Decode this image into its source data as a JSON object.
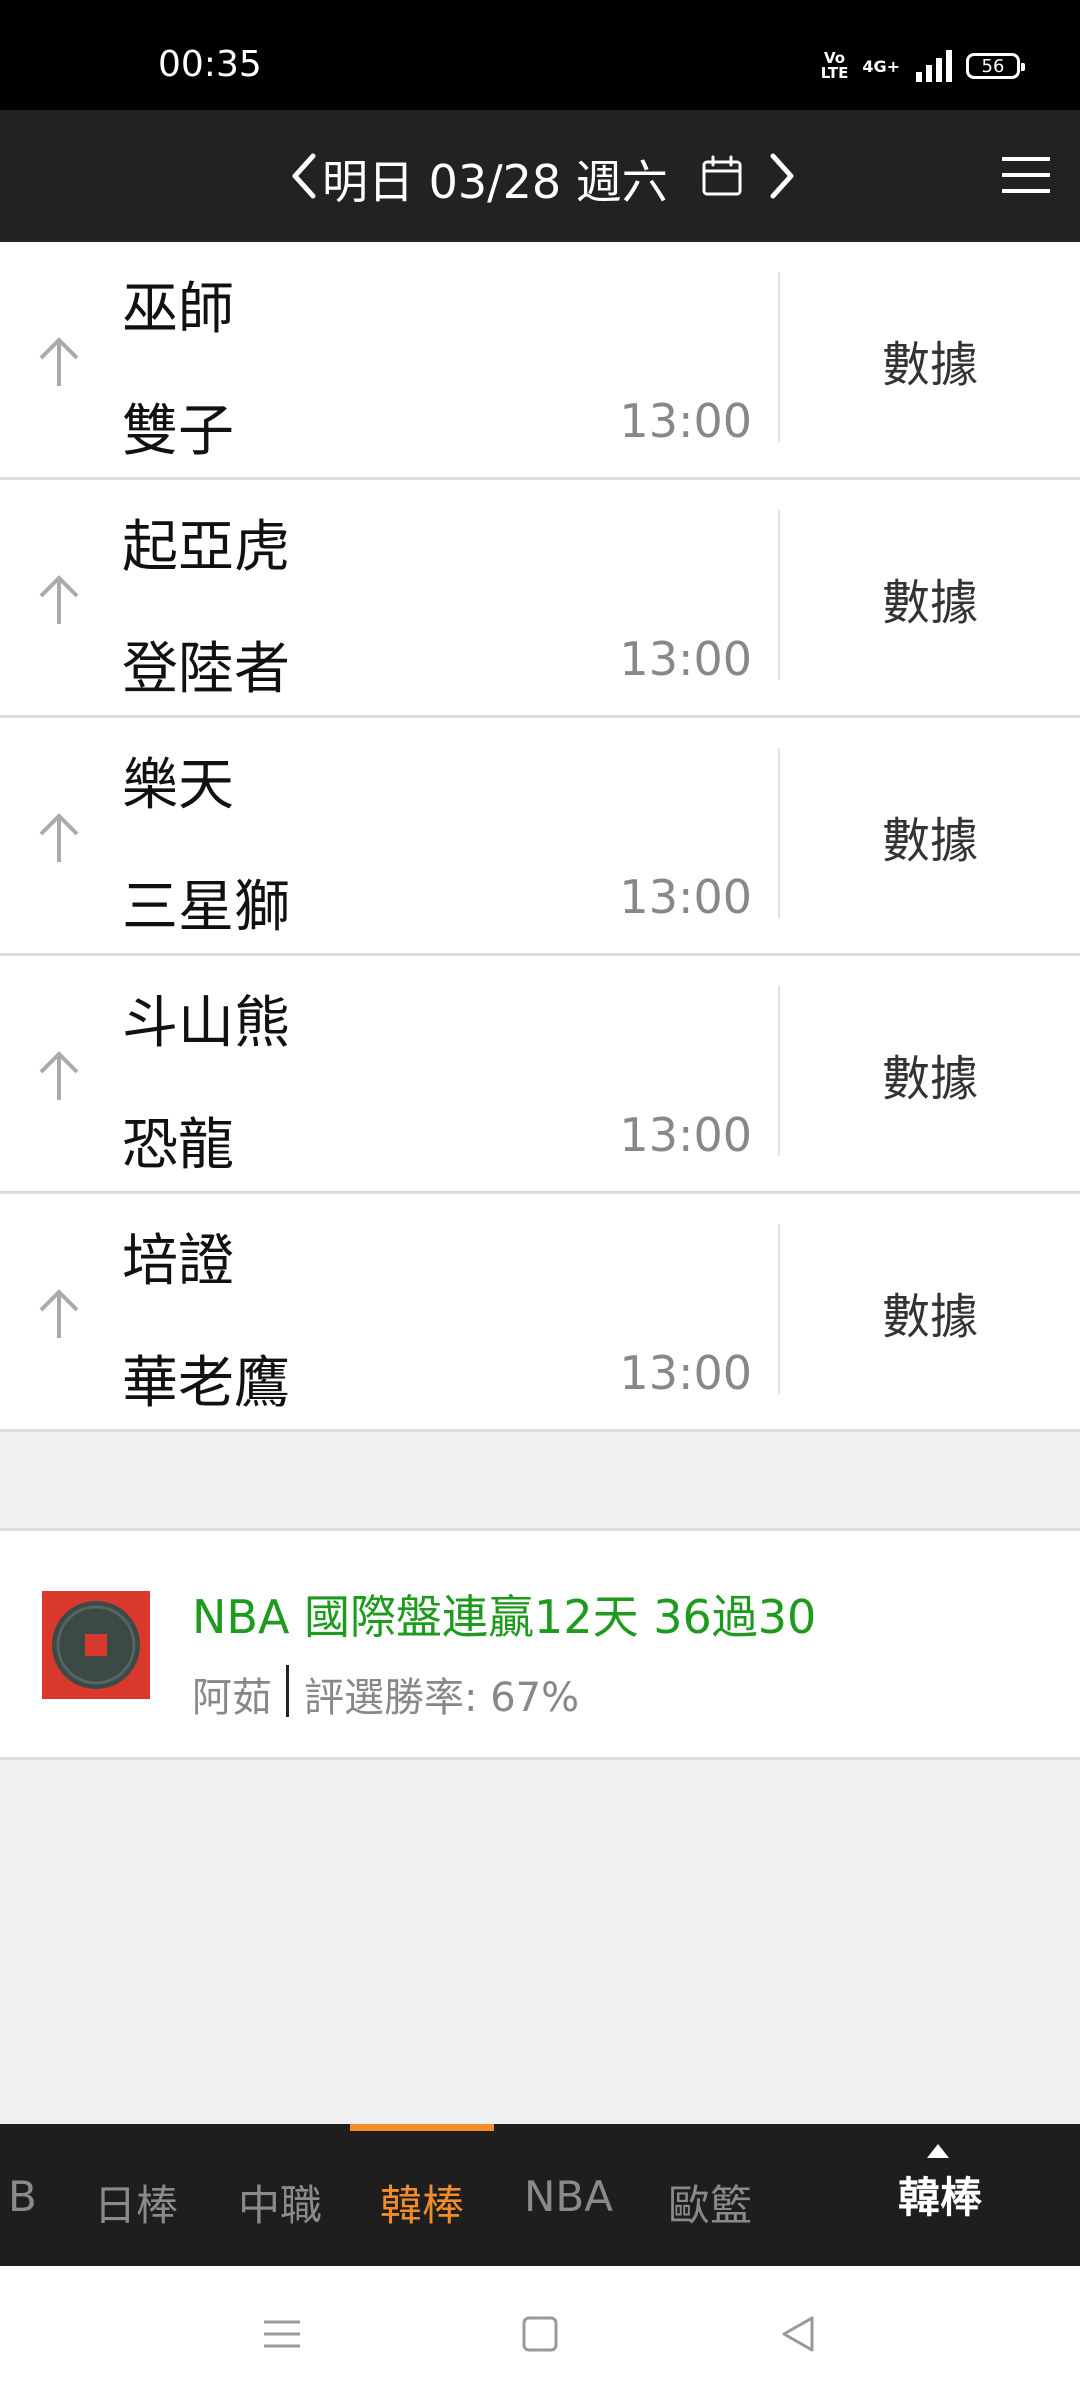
{
  "status_bar": {
    "time": "00:35",
    "volte": "Vo LTE",
    "network": "4G+",
    "battery": "56"
  },
  "header": {
    "date_label": "明日 03/28 週六"
  },
  "games": [
    {
      "home": "巫師",
      "away": "雙子",
      "time": "13:00",
      "action": "數據"
    },
    {
      "home": "起亞虎",
      "away": "登陸者",
      "time": "13:00",
      "action": "數據"
    },
    {
      "home": "樂天",
      "away": "三星獅",
      "time": "13:00",
      "action": "數據"
    },
    {
      "home": "斗山熊",
      "away": "恐龍",
      "time": "13:00",
      "action": "數據"
    },
    {
      "home": "培證",
      "away": "華老鷹",
      "time": "13:00",
      "action": "數據"
    }
  ],
  "promo": {
    "title": "NBA 國際盤連贏12天 36過30",
    "author": "阿茹",
    "win_rate": "評選勝率: 67%"
  },
  "tabs": {
    "items": [
      "B",
      "日棒",
      "中職",
      "韓棒",
      "NBA",
      "歐籃"
    ],
    "active_index": 3,
    "current": "韓棒"
  },
  "colors": {
    "accent": "#f28c28",
    "promo_title": "#1e9a1e",
    "header_bg": "#222222"
  }
}
